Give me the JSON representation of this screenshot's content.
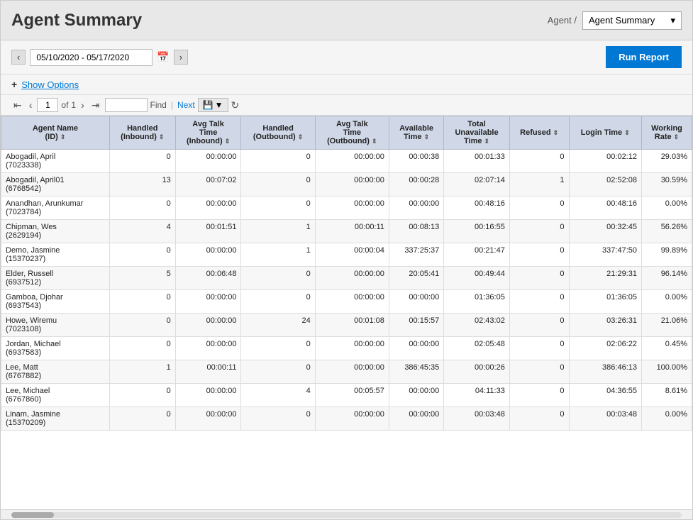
{
  "header": {
    "title": "Agent Summary",
    "breadcrumb": "Agent /",
    "dropdown_value": "Agent Summary",
    "dropdown_chevron": "▾"
  },
  "toolbar": {
    "date_range": "05/10/2020 - 05/17/2020",
    "run_report_label": "Run Report"
  },
  "options": {
    "plus": "+",
    "label": "Show Options"
  },
  "pagination": {
    "current_page": "1",
    "total_pages": "1",
    "of_label": "of",
    "find_placeholder": "",
    "find_label": "Find",
    "next_label": "Next"
  },
  "table": {
    "columns": [
      {
        "label": "Agent Name\n(ID)",
        "sort": "⇕"
      },
      {
        "label": "Handled\n(Inbound)",
        "sort": "⇕"
      },
      {
        "label": "Avg Talk\nTime\n(Inbound)",
        "sort": "⇕"
      },
      {
        "label": "Handled\n(Outbound)",
        "sort": "⇕"
      },
      {
        "label": "Avg Talk\nTime\n(Outbound)",
        "sort": "⇕"
      },
      {
        "label": "Available\nTime",
        "sort": "⇕"
      },
      {
        "label": "Total\nUnavailable\nTime",
        "sort": "⇕"
      },
      {
        "label": "Refused",
        "sort": "⇕"
      },
      {
        "label": "Login Time",
        "sort": "⇕"
      },
      {
        "label": "Working\nRate",
        "sort": "⇕"
      }
    ],
    "rows": [
      [
        "Abogadil, April\n(7023338)",
        "0",
        "00:00:00",
        "0",
        "00:00:00",
        "00:00:38",
        "00:01:33",
        "0",
        "00:02:12",
        "29.03%"
      ],
      [
        "Abogadil, April01\n(6768542)",
        "13",
        "00:07:02",
        "0",
        "00:00:00",
        "00:00:28",
        "02:07:14",
        "1",
        "02:52:08",
        "30.59%"
      ],
      [
        "Anandhan, Arunkumar\n(7023784)",
        "0",
        "00:00:00",
        "0",
        "00:00:00",
        "00:00:00",
        "00:48:16",
        "0",
        "00:48:16",
        "0.00%"
      ],
      [
        "Chipman, Wes\n(2629194)",
        "4",
        "00:01:51",
        "1",
        "00:00:11",
        "00:08:13",
        "00:16:55",
        "0",
        "00:32:45",
        "56.26%"
      ],
      [
        "Demo, Jasmine\n(15370237)",
        "0",
        "00:00:00",
        "1",
        "00:00:04",
        "337:25:37",
        "00:21:47",
        "0",
        "337:47:50",
        "99.89%"
      ],
      [
        "Elder, Russell\n(6937512)",
        "5",
        "00:06:48",
        "0",
        "00:00:00",
        "20:05:41",
        "00:49:44",
        "0",
        "21:29:31",
        "96.14%"
      ],
      [
        "Gamboa, Djohar\n(6937543)",
        "0",
        "00:00:00",
        "0",
        "00:00:00",
        "00:00:00",
        "01:36:05",
        "0",
        "01:36:05",
        "0.00%"
      ],
      [
        "Howe, Wiremu\n(7023108)",
        "0",
        "00:00:00",
        "24",
        "00:01:08",
        "00:15:57",
        "02:43:02",
        "0",
        "03:26:31",
        "21.06%"
      ],
      [
        "Jordan, Michael\n(6937583)",
        "0",
        "00:00:00",
        "0",
        "00:00:00",
        "00:00:00",
        "02:05:48",
        "0",
        "02:06:22",
        "0.45%"
      ],
      [
        "Lee, Matt\n(6767882)",
        "1",
        "00:00:11",
        "0",
        "00:00:00",
        "386:45:35",
        "00:00:26",
        "0",
        "386:46:13",
        "100.00%"
      ],
      [
        "Lee, Michael\n(6767860)",
        "0",
        "00:00:00",
        "4",
        "00:05:57",
        "00:00:00",
        "04:11:33",
        "0",
        "04:36:55",
        "8.61%"
      ],
      [
        "Linam, Jasmine\n(15370209)",
        "0",
        "00:00:00",
        "0",
        "00:00:00",
        "00:00:00",
        "00:03:48",
        "0",
        "00:03:48",
        "0.00%"
      ]
    ]
  }
}
